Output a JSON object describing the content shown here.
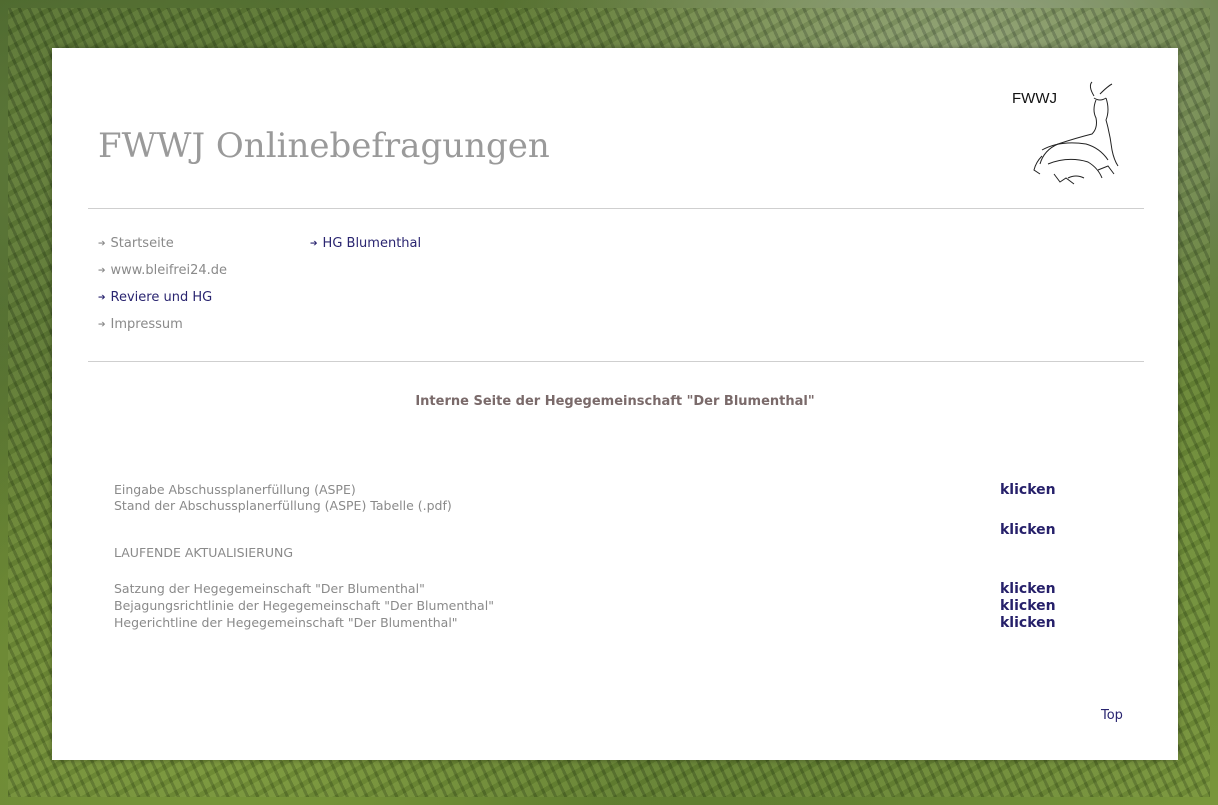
{
  "header": {
    "title": "FWWJ Onlinebefragungen",
    "logo_text": "FWWJ"
  },
  "nav": {
    "items": [
      {
        "label": "Startseite",
        "active": false
      },
      {
        "label": "www.bleifrei24.de",
        "active": false
      },
      {
        "label": "Reviere und HG",
        "active": true
      },
      {
        "label": "Impressum",
        "active": false
      }
    ],
    "sub": {
      "label": "HG Blumenthal"
    }
  },
  "main": {
    "title": "Interne Seite der Hegegemeinschaft \"Der Blumenthal\"",
    "rows": {
      "aspe_input": "Eingabe Abschussplanerfüllung (ASPE)",
      "aspe_table": "Stand der Abschussplanerfüllung (ASPE) Tabelle (.pdf)",
      "updating": "LAUFENDE AKTUALISIERUNG",
      "satzung": "Satzung der Hegegemeinschaft \"Der Blumenthal\"",
      "bejagung": "Bejagungsrichtlinie der Hegegemeinschaft \"Der Blumenthal\"",
      "hege": "Hegerichtline der Hegegemeinschaft \"Der Blumenthal\""
    },
    "link_label": "klicken"
  },
  "footer": {
    "top_label": "Top"
  },
  "colors": {
    "nav_active": "#2a2570",
    "link": "#26206a",
    "muted_text": "#8a8a8a"
  },
  "icons": {
    "nav_bullet": "arrow-right-icon",
    "logo": "deer-logo-icon"
  }
}
